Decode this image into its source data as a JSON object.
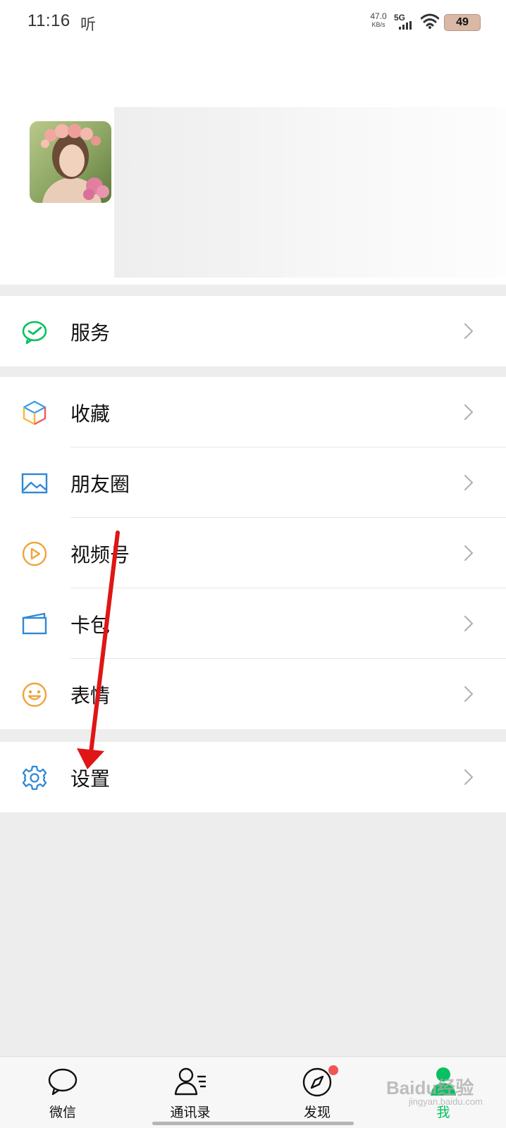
{
  "status_bar": {
    "time": "11:16",
    "listen_label": "听",
    "net_speed_value": "47.0",
    "net_speed_unit": "KB/s",
    "network": "5G",
    "battery": "49"
  },
  "profile": {
    "avatar_icon": "avatar-photo"
  },
  "menu": {
    "service": {
      "label": "服务",
      "icon": "wechat-pay-icon"
    },
    "favorites": {
      "label": "收藏",
      "icon": "cube-icon"
    },
    "moments": {
      "label": "朋友圈",
      "icon": "picture-icon"
    },
    "channels": {
      "label": "视频号",
      "icon": "play-circle-icon"
    },
    "cards": {
      "label": "卡包",
      "icon": "card-wallet-icon"
    },
    "stickers": {
      "label": "表情",
      "icon": "smiley-icon"
    },
    "settings": {
      "label": "设置",
      "icon": "gear-icon"
    }
  },
  "tabbar": {
    "tabs": [
      {
        "label": "微信",
        "icon": "chat-bubble-icon"
      },
      {
        "label": "通讯录",
        "icon": "contacts-icon"
      },
      {
        "label": "发现",
        "icon": "compass-icon"
      },
      {
        "label": "我",
        "icon": "person-icon"
      }
    ]
  },
  "watermark": {
    "text": "Baidu经验",
    "sub": "jingyan.baidu.com"
  },
  "colors": {
    "accent_green": "#07c160",
    "arrow_red": "#e01515",
    "badge_red": "#f25353",
    "page_bg": "#ededed"
  }
}
